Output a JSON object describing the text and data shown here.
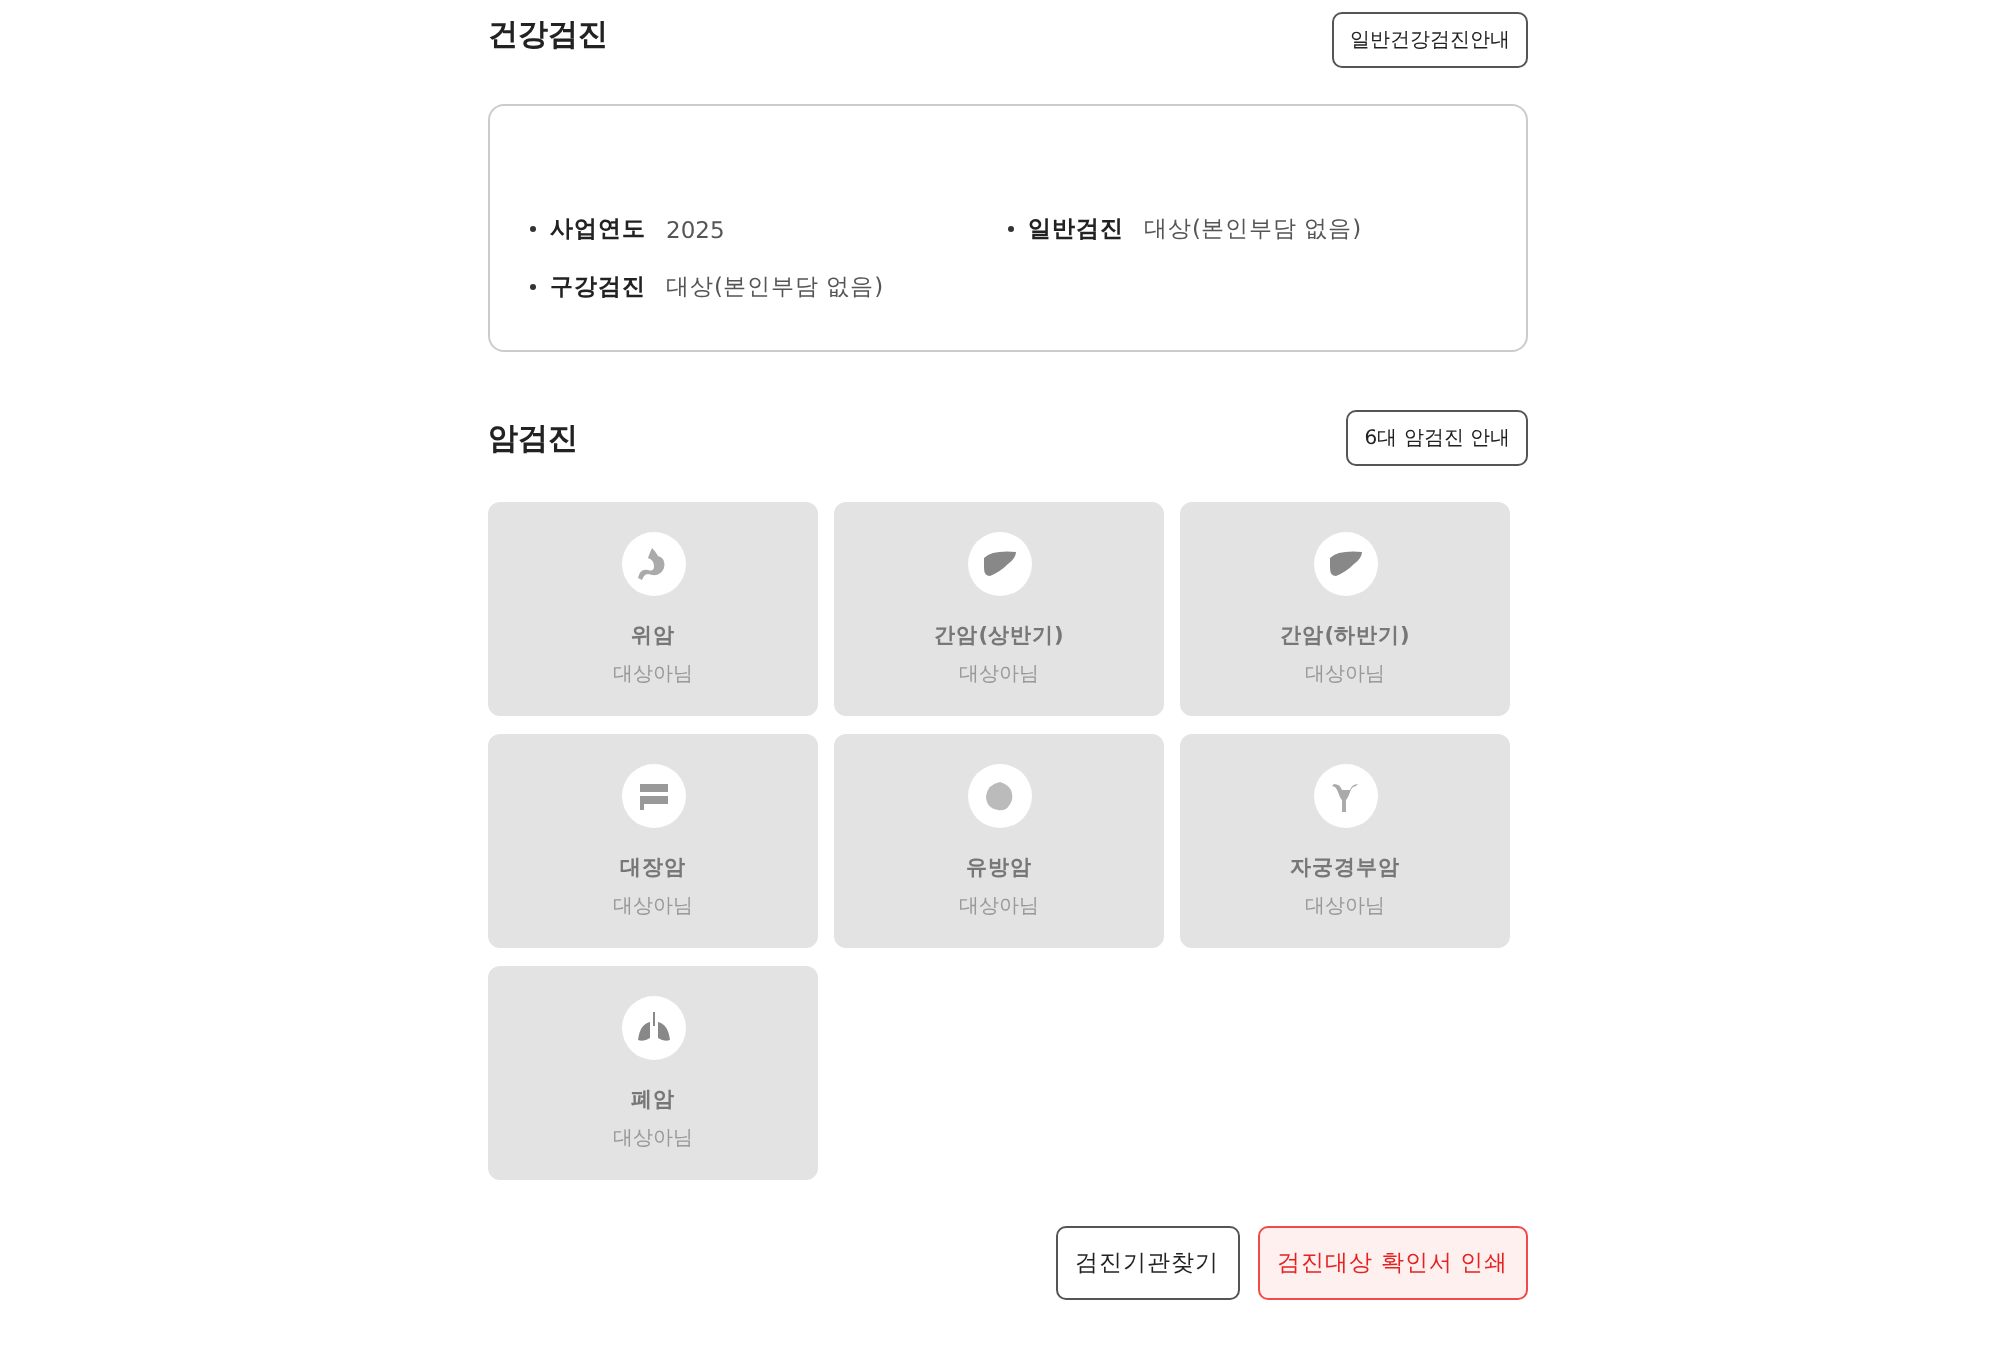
{
  "health_checkup": {
    "title": "건강검진",
    "guide_button": "일반건강검진안내",
    "info": [
      {
        "label": "사업연도",
        "value": "2025"
      },
      {
        "label": "일반검진",
        "value": "대상(본인부담 없음)"
      },
      {
        "label": "구강검진",
        "value": "대상(본인부담 없음)"
      }
    ]
  },
  "cancer_checkup": {
    "title": "암검진",
    "guide_button": "6대 암검진 안내",
    "cards": [
      {
        "kind": "stomach",
        "name": "위암",
        "status": "대상아님",
        "disabled": true
      },
      {
        "kind": "liver",
        "name": "간암(상반기)",
        "status": "대상아님",
        "disabled": true
      },
      {
        "kind": "liver",
        "name": "간암(하반기)",
        "status": "대상아님",
        "disabled": true
      },
      {
        "kind": "colon",
        "name": "대장암",
        "status": "대상아님",
        "disabled": true
      },
      {
        "kind": "breast",
        "name": "유방암",
        "status": "대상아님",
        "disabled": true
      },
      {
        "kind": "uterus",
        "name": "자궁경부암",
        "status": "대상아님",
        "disabled": true
      },
      {
        "kind": "lung",
        "name": "폐암",
        "status": "대상아님",
        "disabled": true
      }
    ]
  },
  "actions": [
    {
      "kind": "default",
      "label": "검진기관찾기"
    },
    {
      "kind": "primary",
      "label": "검진대상 확인서 인쇄"
    }
  ]
}
